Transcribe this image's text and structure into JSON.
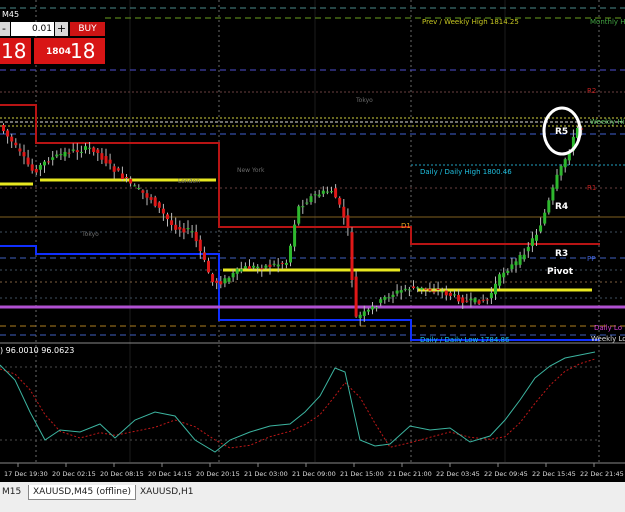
{
  "trade_panel": {
    "symbol": "M45",
    "lot_minus": "-",
    "lot_value": "0.01",
    "lot_plus": "+",
    "buy_label": "BUY",
    "sell_price_big": "18",
    "buy_price_small": "1804",
    "buy_price_big": "18"
  },
  "chart_labels": {
    "prev_weekly_high": "Prev / Weekly High 1814.25",
    "monthly_high": "Monthly Hi",
    "weekly_high": "Weekly Hi",
    "tokyo_top": "Tokyo",
    "new_york": "New York",
    "london": "London",
    "tokyo_mid": "Tokyo",
    "daily_high": "Daily / Daily High 1800.46",
    "daily_low": "Daily / Daily Low 1784.86",
    "daily_low_right": "Daily Lo",
    "weekly_low_right": "Weekly Lo",
    "r5": "R5",
    "r4": "R4",
    "r3": "R3",
    "pivot": "Pivot",
    "r2_right": "R2",
    "r1_right": "R1",
    "pp_right": "PP",
    "d1": "D1"
  },
  "oscillator": {
    "label": ") 96.0010 96.0623"
  },
  "time_axis": [
    "17 Dec 19:30",
    "20 Dec 02:15",
    "20 Dec 08:15",
    "20 Dec 14:15",
    "20 Dec 20:15",
    "21 Dec 03:00",
    "21 Dec 09:00",
    "21 Dec 15:00",
    "21 Dec 21:00",
    "22 Dec 03:45",
    "22 Dec 09:45",
    "22 Dec 15:45",
    "22 Dec 21:45"
  ],
  "tabs": [
    {
      "label": "M15"
    },
    {
      "label": "XAUUSD,M45 (offline)"
    },
    {
      "label": "XAUUSD,H1"
    }
  ],
  "colors": {
    "bull": "#2eb82e",
    "bear": "#e01818",
    "pivot_line": "#e8e820",
    "daily_high_line": "#b81414",
    "daily_low_line": "#1030ff",
    "weekly_line": "#b050d0",
    "osc_main": "#3cb4a0",
    "osc_signal": "#c01818",
    "label_cyan": "#20c0e0"
  },
  "chart_data": {
    "type": "candlestick",
    "x": [
      "17 Dec 19:30",
      "20 Dec 02:15",
      "20 Dec 08:15",
      "20 Dec 14:15",
      "20 Dec 20:15",
      "21 Dec 03:00",
      "21 Dec 09:00",
      "21 Dec 15:00",
      "21 Dec 21:00",
      "22 Dec 03:45",
      "22 Dec 09:45",
      "22 Dec 15:45",
      "22 Dec 21:45"
    ],
    "levels": {
      "prev_weekly_high": 1814.25,
      "daily_high": 1800.46,
      "daily_low": 1784.86
    },
    "oscillator_values": [
      96.001,
      96.0623
    ]
  }
}
